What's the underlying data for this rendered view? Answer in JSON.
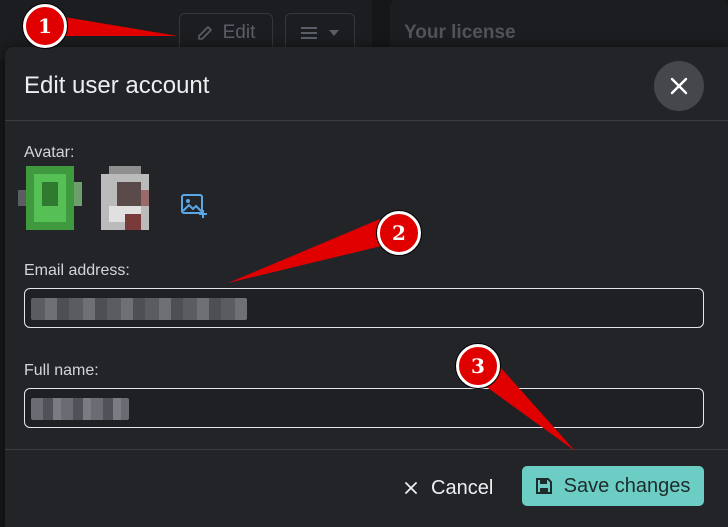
{
  "background": {
    "edit_label": "Edit",
    "license_title": "Your license"
  },
  "modal": {
    "title": "Edit user account",
    "avatar_label": "Avatar:",
    "email_label": "Email address:",
    "fullname_label": "Full name:",
    "cancel_label": "Cancel",
    "save_label": "Save changes"
  },
  "annotations": {
    "marker_1": "1",
    "marker_2": "2",
    "marker_3": "3",
    "color": "#e00000"
  },
  "colors": {
    "accent": "#6ccdc4",
    "modal_bg": "#232428",
    "page_bg": "#161719"
  }
}
